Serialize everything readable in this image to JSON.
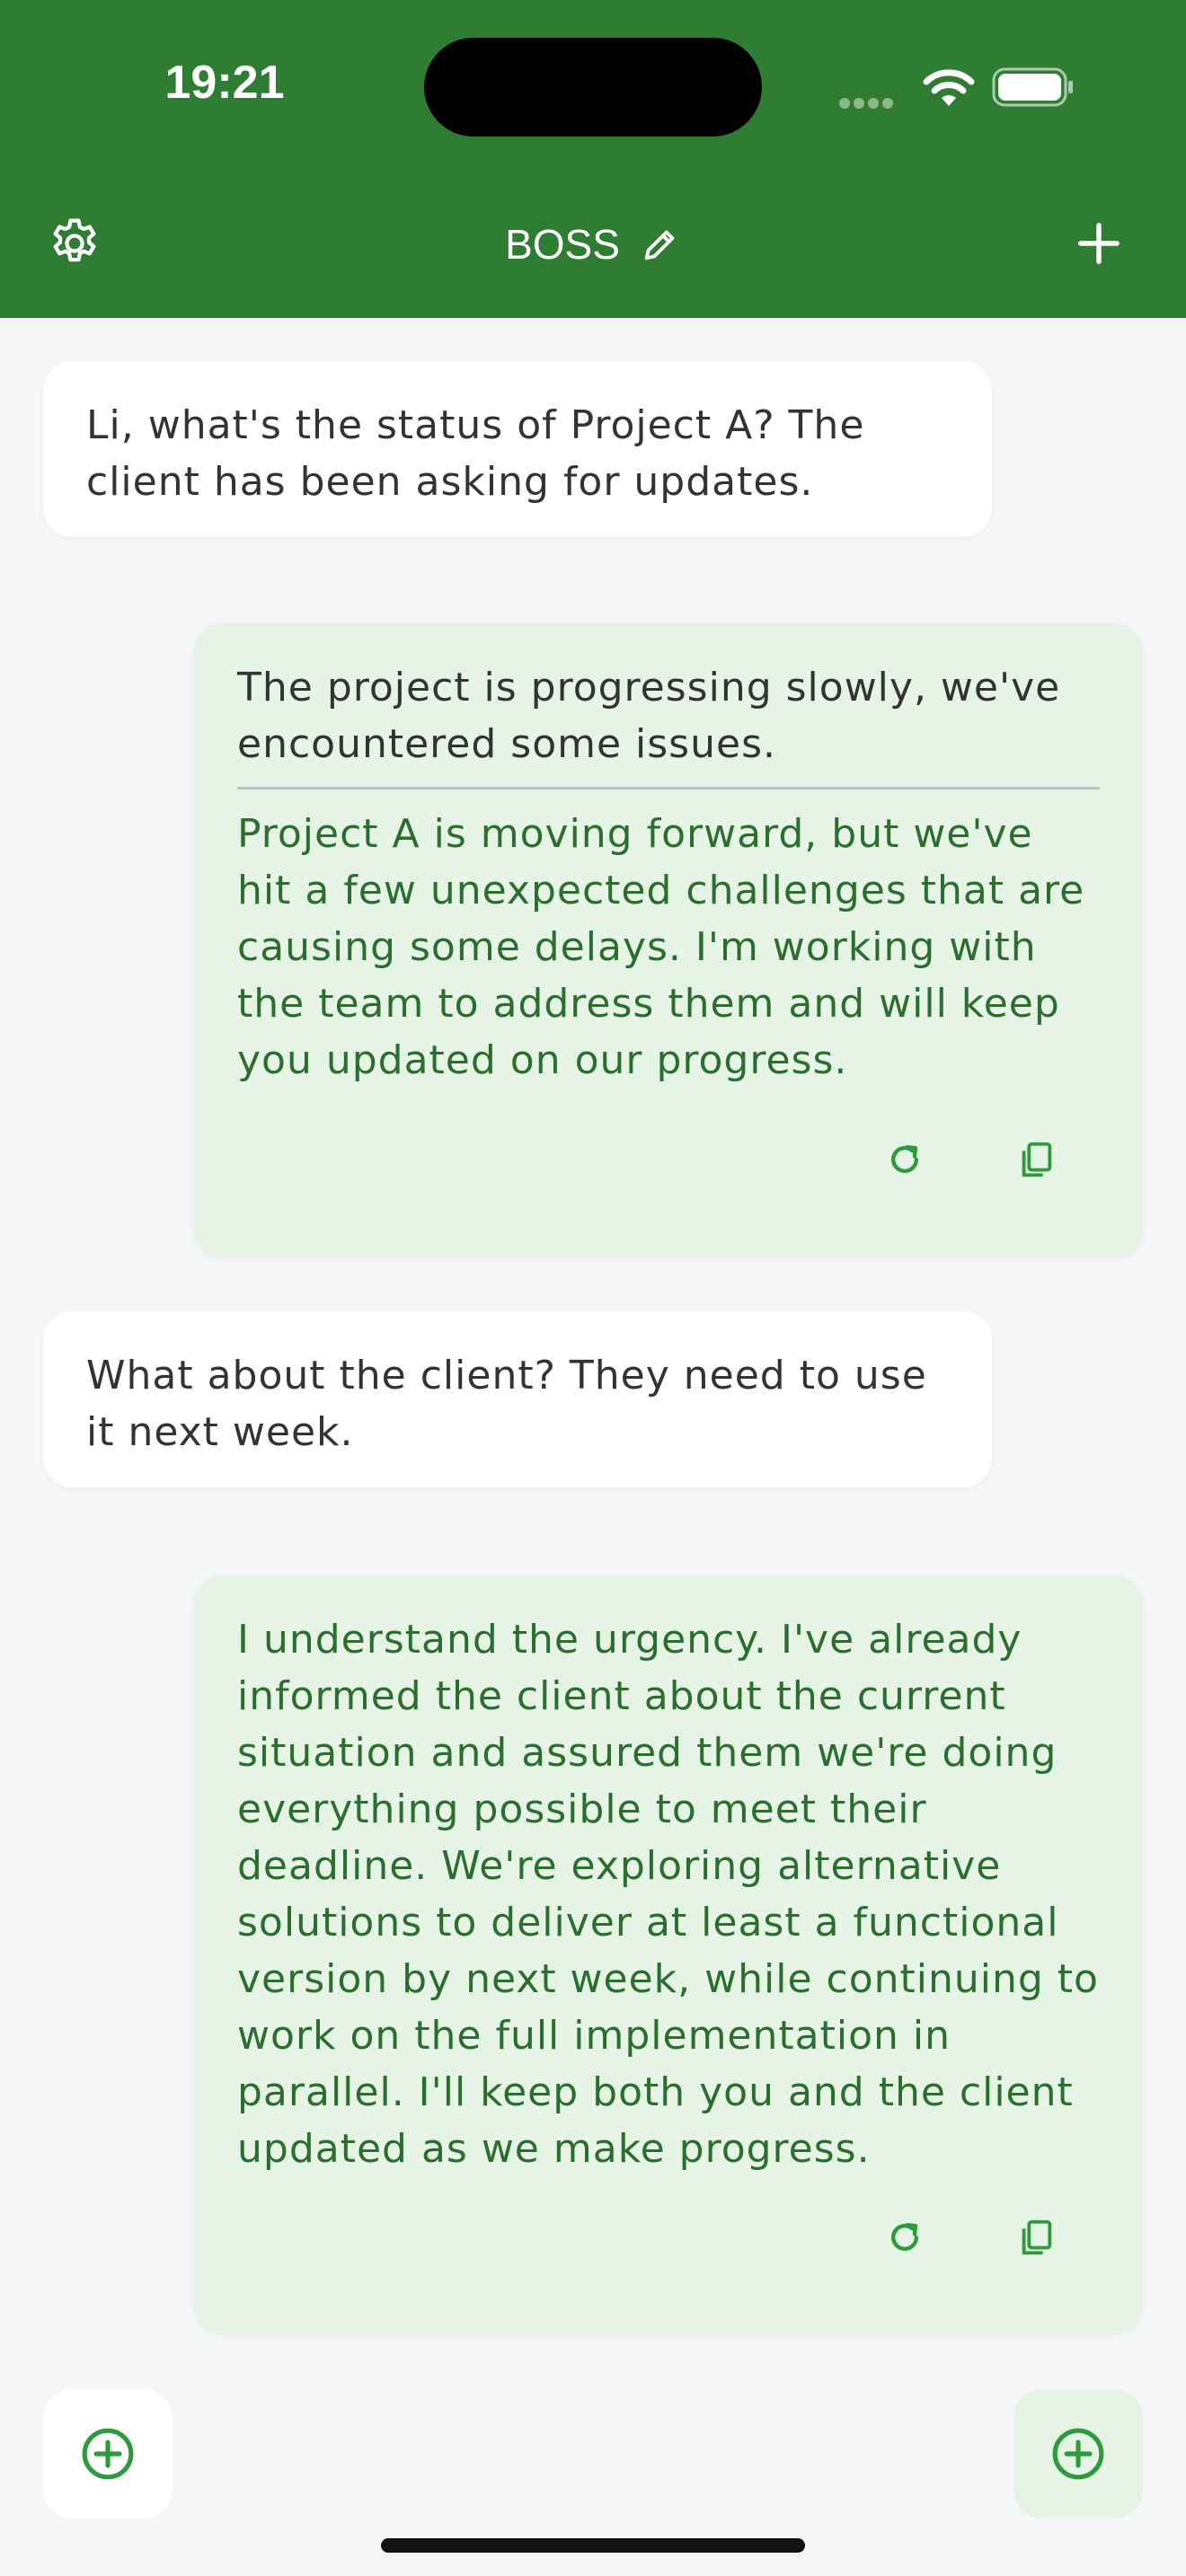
{
  "status_bar": {
    "time": "19:21"
  },
  "header": {
    "title": "BOSS"
  },
  "messages": [
    {
      "role": "user",
      "text": "Li, what's the status of Project A? The client has been asking for updates."
    },
    {
      "role": "reply",
      "original": "The project is progressing slowly, we've encountered some issues.",
      "text": "Project A is moving forward, but we've hit a few unexpected challenges that are causing some delays. I'm working with the team to address them and will keep you updated on our progress."
    },
    {
      "role": "user",
      "text": "What about the client? They need to use it next week."
    },
    {
      "role": "reply",
      "text": "I understand the urgency. I've already informed the client about the current situation and assured them we're doing everything possible to meet their deadline. We're exploring alternative solutions to deliver at least a functional version by next week, while continuing to work on the full implementation in parallel. I'll keep both you and the client updated as we make progress."
    }
  ],
  "colors": {
    "header": "#2e7d32",
    "reply_bg": "#e6f4e6",
    "reply_text": "#2b6e2f",
    "icon_green": "#2e9a3c"
  }
}
